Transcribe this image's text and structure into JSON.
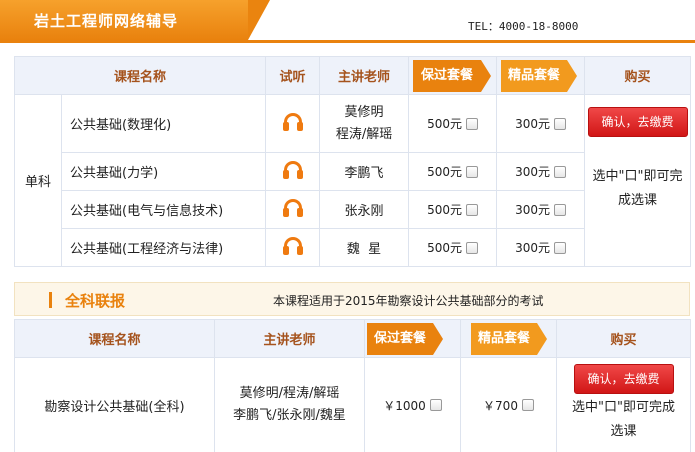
{
  "header": {
    "title": "岩土工程师网络辅导",
    "tel": "TEL：4000-18-8000"
  },
  "table1": {
    "headers": {
      "course": "课程名称",
      "trial": "试听",
      "teacher": "主讲老师",
      "pass_pkg": "保过套餐",
      "premium_pkg": "精品套餐",
      "buy": "购买"
    },
    "category": "单科",
    "rows": [
      {
        "course": "公共基础(数理化)",
        "teacher_line1": "莫修明",
        "teacher_line2": "程涛/解瑶",
        "pass_price": "500元",
        "premium_price": "300元"
      },
      {
        "course": "公共基础(力学)",
        "teacher_line1": "李鹏飞",
        "teacher_line2": "",
        "pass_price": "500元",
        "premium_price": "300元"
      },
      {
        "course": "公共基础(电气与信息技术)",
        "teacher_line1": "张永刚",
        "teacher_line2": "",
        "pass_price": "500元",
        "premium_price": "300元"
      },
      {
        "course": "公共基础(工程经济与法律)",
        "teacher_line1": "魏  星",
        "teacher_line2": "",
        "pass_price": "500元",
        "premium_price": "300元"
      }
    ],
    "buy_button": "确认，去缴费",
    "buy_note": "选中\"口\"即可完成选课"
  },
  "section2": {
    "title": "全科联报",
    "note": "本课程适用于2015年勘察设计公共基础部分的考试"
  },
  "table2": {
    "headers": {
      "course": "课程名称",
      "teacher": "主讲老师",
      "pass_pkg": "保过套餐",
      "premium_pkg": "精品套餐",
      "buy": "购买"
    },
    "row": {
      "course": "勘察设计公共基础(全科)",
      "teacher_line1": "莫修明/程涛/解瑶",
      "teacher_line2": "李鹏飞/张永刚/魏星",
      "pass_price": "￥1000",
      "premium_price": "￥700"
    },
    "buy_button": "确认，去缴费",
    "buy_note": "选中\"口\"即可完成选课"
  },
  "colors": {
    "accent_orange": "#e9820e",
    "header_text": "#a5531d",
    "button_red": "#d11616"
  }
}
